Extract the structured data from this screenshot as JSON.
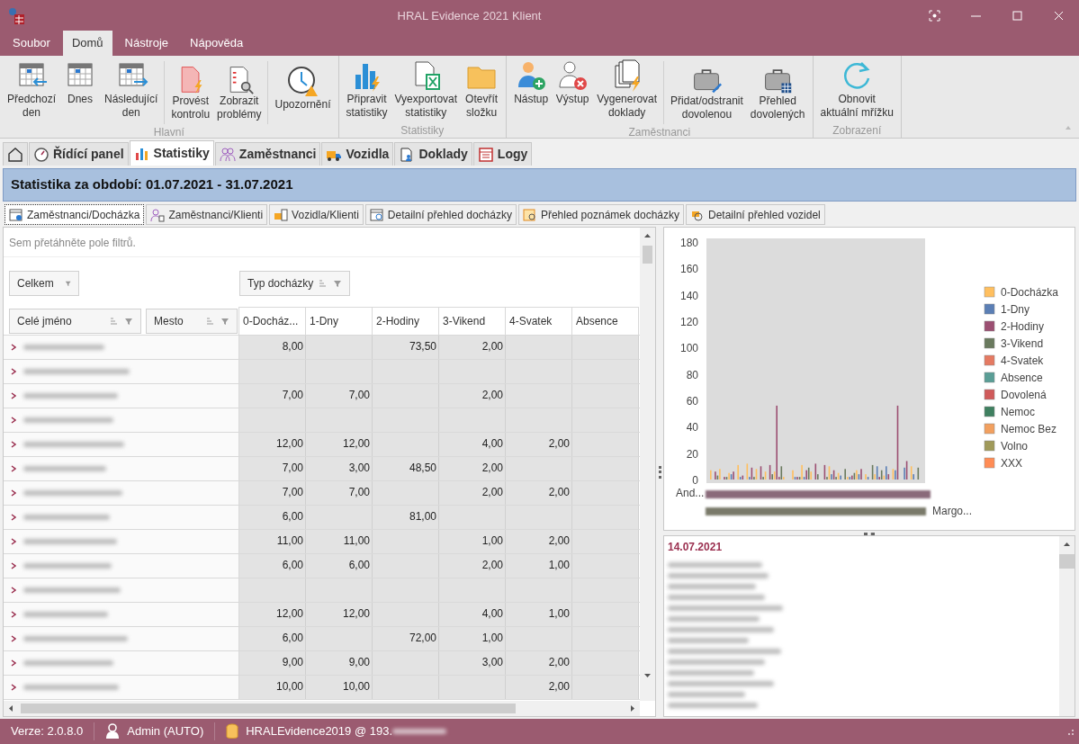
{
  "window": {
    "title": "HRAL Evidence 2021 Klient"
  },
  "ribbon": {
    "tabs": [
      {
        "label": "Soubor",
        "selected": false
      },
      {
        "label": "Domů",
        "selected": true
      },
      {
        "label": "Nástroje",
        "selected": false
      },
      {
        "label": "Nápověda",
        "selected": false
      }
    ],
    "groups": [
      {
        "label": "Hlavní",
        "sections": [
          [
            {
              "label": "Předchozí\nden"
            },
            {
              "label": "Dnes"
            },
            {
              "label": "Následující\nden"
            }
          ],
          [
            {
              "label": "Provést\nkontrolu"
            },
            {
              "label": "Zobrazit\nproblémy"
            }
          ],
          [
            {
              "label": "Upozornění"
            }
          ]
        ]
      },
      {
        "label": "Statistiky",
        "sections": [
          [
            {
              "label": "Připravit\nstatistiky"
            },
            {
              "label": "Vyexportovat\nstatistiky"
            },
            {
              "label": "Otevřít\nsložku"
            }
          ]
        ]
      },
      {
        "label": "Zaměstnanci",
        "sections": [
          [
            {
              "label": "Nástup"
            },
            {
              "label": "Výstup"
            },
            {
              "label": "Vygenerovat\ndoklady"
            }
          ],
          [
            {
              "label": "Přidat/odstranit\ndovolenou"
            },
            {
              "label": "Přehled\ndovolených"
            }
          ]
        ]
      },
      {
        "label": "Zobrazení",
        "sections": [
          [
            {
              "label": "Obnovit\naktuální mřížku"
            }
          ]
        ]
      }
    ]
  },
  "main_tabs": [
    {
      "selected": false
    },
    {
      "label": "Řídící panel",
      "selected": false
    },
    {
      "label": "Statistiky",
      "selected": true
    },
    {
      "label": "Zaměstnanci",
      "selected": false
    },
    {
      "label": "Vozidla",
      "selected": false
    },
    {
      "label": "Doklady",
      "selected": false
    },
    {
      "label": "Logy",
      "selected": false
    }
  ],
  "period_header": "Statistika za období: 01.07.2021 - 31.07.2021",
  "sub_tabs": [
    {
      "label": "Zaměstnanci/Docházka",
      "selected": true
    },
    {
      "label": "Zaměstnanci/Klienti",
      "selected": false
    },
    {
      "label": "Vozidla/Klienti",
      "selected": false
    },
    {
      "label": "Detailní přehled docházky",
      "selected": false
    },
    {
      "label": "Přehled poznámek docházky",
      "selected": false
    },
    {
      "label": "Detailní přehled vozidel",
      "selected": false
    }
  ],
  "pivot": {
    "filter_placeholder": "Sem přetáhněte pole filtrů.",
    "data_field": "Celkem",
    "column_field": "Typ docházky",
    "row_fields": [
      "Celé jméno",
      "Mesto"
    ],
    "columns": [
      "0-Docház...",
      "1-Dny",
      "2-Hodiny",
      "3-Vikend",
      "4-Svatek",
      "Absence"
    ],
    "rows": [
      [
        "8,00",
        "",
        "73,50",
        "2,00",
        "",
        ""
      ],
      [
        "",
        "",
        "",
        "",
        "",
        ""
      ],
      [
        "7,00",
        "7,00",
        "",
        "2,00",
        "",
        ""
      ],
      [
        "",
        "",
        "",
        "",
        "",
        ""
      ],
      [
        "12,00",
        "12,00",
        "",
        "4,00",
        "2,00",
        ""
      ],
      [
        "7,00",
        "3,00",
        "48,50",
        "2,00",
        "",
        ""
      ],
      [
        "7,00",
        "7,00",
        "",
        "2,00",
        "2,00",
        ""
      ],
      [
        "6,00",
        "",
        "81,00",
        "",
        "",
        ""
      ],
      [
        "11,00",
        "11,00",
        "",
        "1,00",
        "2,00",
        ""
      ],
      [
        "6,00",
        "6,00",
        "",
        "2,00",
        "1,00",
        ""
      ],
      [
        "",
        "",
        "",
        "",
        "",
        ""
      ],
      [
        "12,00",
        "12,00",
        "",
        "4,00",
        "1,00",
        ""
      ],
      [
        "6,00",
        "",
        "72,00",
        "1,00",
        "",
        ""
      ],
      [
        "9,00",
        "9,00",
        "",
        "3,00",
        "2,00",
        ""
      ],
      [
        "10,00",
        "10,00",
        "",
        "",
        "2,00",
        ""
      ]
    ]
  },
  "chart": {
    "y_ticks": [
      "180",
      "160",
      "140",
      "120",
      "100",
      "80",
      "60",
      "40",
      "20",
      "0"
    ],
    "x_labels": [
      "And...",
      "Margo..."
    ],
    "legend": [
      {
        "label": "0-Docházka",
        "color": "#ffbf5f"
      },
      {
        "label": "1-Dny",
        "color": "#5b7fb5"
      },
      {
        "label": "2-Hodiny",
        "color": "#9c4f72"
      },
      {
        "label": "3-Vikend",
        "color": "#6a7a5e"
      },
      {
        "label": "4-Svatek",
        "color": "#e57a62"
      },
      {
        "label": "Absence",
        "color": "#5a9e96"
      },
      {
        "label": "Dovolená",
        "color": "#d05a5a"
      },
      {
        "label": "Nemoc",
        "color": "#3f8060"
      },
      {
        "label": "Nemoc Bez",
        "color": "#f2a05f"
      },
      {
        "label": "Volno",
        "color": "#a09a5a"
      },
      {
        "label": "XXX",
        "color": "#ff8c55"
      }
    ]
  },
  "detail": {
    "date": "14.07.2021"
  },
  "status_bar": {
    "version": "Verze: 2.0.8.0",
    "user": "Admin (AUTO)",
    "database": "HRALEvidence2019 @ 193."
  }
}
